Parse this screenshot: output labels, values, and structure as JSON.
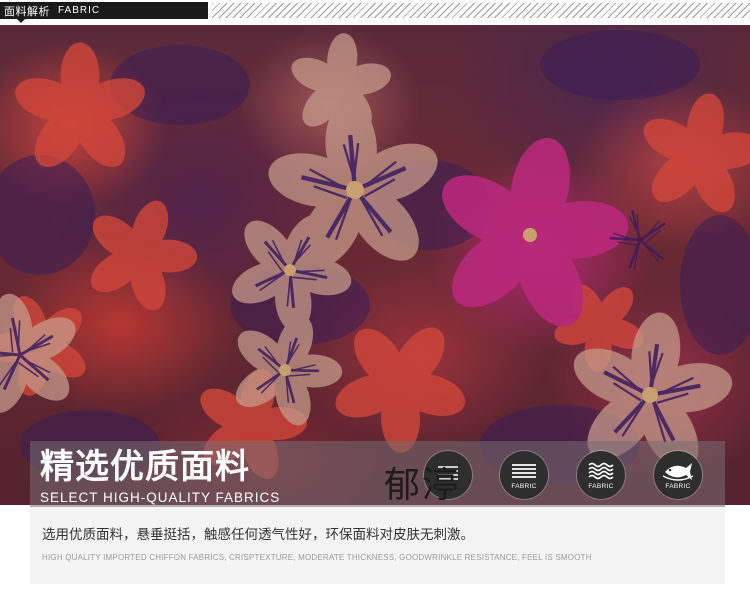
{
  "header": {
    "label_cn": "面料解析",
    "label_en": "FABRIC"
  },
  "fabric_image": {
    "subject": "floral chiffon fabric print",
    "colors": {
      "red": "#d2463c",
      "magenta": "#be2878",
      "purple": "#3c1e5a",
      "tan": "#a87a6a"
    }
  },
  "banner": {
    "title": "精选优质面料",
    "subtitle": "SELECT HIGH-QUALITY FABRICS",
    "icons": [
      {
        "icon": "drape-lines-icon",
        "label": ""
      },
      {
        "icon": "stack-lines-icon",
        "label": "FABRIC"
      },
      {
        "icon": "wave-lines-icon",
        "label": "FABRIC"
      },
      {
        "icon": "fish-icon",
        "label": "FABRIC"
      }
    ]
  },
  "watermark": "郁渟",
  "description": {
    "cn": "选用优质面料，悬垂挺括，触感任何透气性好，环保面料对皮肤无刺激。",
    "en": "HIGH QUALITY IMPORTED CHIFFON FABRICS, CRISPTEXTURE, MODERATE THICKNESS, GOODWRINKLE RESISTANCE, FEEL IS SMOOTH"
  }
}
